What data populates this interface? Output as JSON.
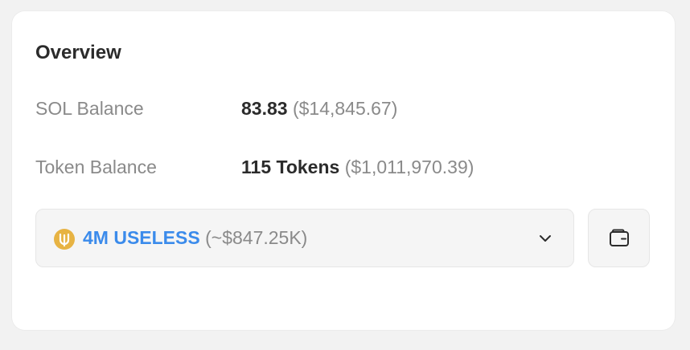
{
  "overview": {
    "title": "Overview",
    "sol_balance": {
      "label": "SOL Balance",
      "amount": "83.83",
      "usd": "($14,845.67)"
    },
    "token_balance": {
      "label": "Token Balance",
      "amount": "115 Tokens",
      "usd": "($1,011,970.39)"
    },
    "token_selector": {
      "amount": "4M USELESS",
      "usd": "(~$847.25K)",
      "icon": "useless-token-icon"
    },
    "wallet_button_icon": "wallet-icon"
  },
  "colors": {
    "accent": "#3b8beb",
    "token_icon": "#e7b343",
    "muted_text": "#8a8a8a",
    "strong_text": "#2b2b2b"
  }
}
